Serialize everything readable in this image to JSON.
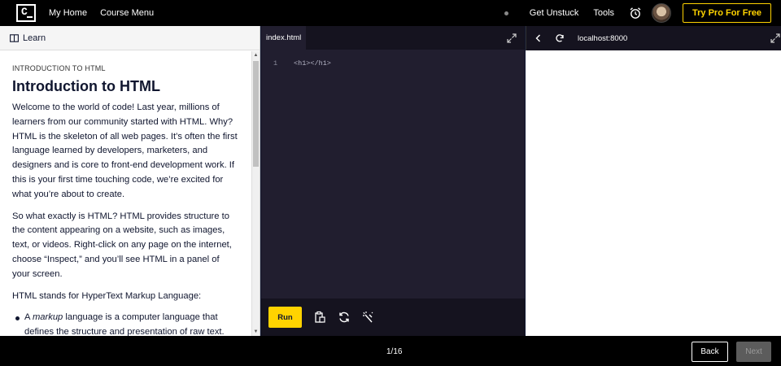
{
  "topnav": {
    "logo_icon": "codecademy-logo-icon",
    "my_home": "My Home",
    "course_menu": "Course Menu",
    "get_unstuck": "Get Unstuck",
    "tools": "Tools",
    "alarm_icon": "alarm-clock-icon",
    "try_pro": "Try Pro For Free",
    "pro_color": "#ffd300"
  },
  "learn": {
    "tab_label": "Learn",
    "tab_icon": "book-icon",
    "eyebrow": "INTRODUCTION TO HTML",
    "title": "Introduction to HTML",
    "paragraphs": [
      "Welcome to the world of code! Last year, millions of learners from our community started with HTML. Why? HTML is the skeleton of all web pages. It’s often the first language learned by developers, marketers, and designers and is core to front-end development work. If this is your first time touching code, we’re excited for what you’re about to create.",
      "So what exactly is HTML? HTML provides structure to the content appearing on a website, such as images, text, or videos. Right-click on any page on the internet, choose “Inspect,” and you’ll see HTML in a panel of your screen.",
      "HTML stands for HyperText Markup Language:"
    ],
    "bullet_1_prefix": "A ",
    "bullet_1_em": "markup",
    "bullet_1_rest": " language is a computer language that defines the structure and presentation of raw text."
  },
  "editor": {
    "tab": "index.html",
    "line_number": "1",
    "code": "<h1></h1>",
    "run_label": "Run",
    "tool_icons": [
      "copy-icon",
      "reset-icon",
      "snippet-icon"
    ]
  },
  "browser": {
    "url": "localhost:8000",
    "back_icon": "chevron-left-icon",
    "refresh_icon": "refresh-icon"
  },
  "bottom": {
    "progress": "1/16",
    "back_label": "Back",
    "next_label": "Next"
  }
}
